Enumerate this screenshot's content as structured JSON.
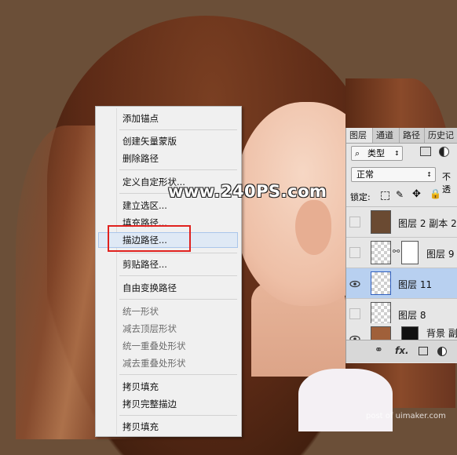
{
  "watermark": "www.240PS.com",
  "watermark_bottom": "post of uimaker.com",
  "context_menu": {
    "items": [
      {
        "label": "添加锚点",
        "enabled": true
      },
      {
        "label": "创建矢量蒙版",
        "enabled": true
      },
      {
        "label": "删除路径",
        "enabled": true
      },
      {
        "label": "定义自定形状...",
        "enabled": true
      },
      {
        "label": "建立选区...",
        "enabled": true
      },
      {
        "label": "填充路径...",
        "enabled": true
      },
      {
        "label": "描边路径...",
        "enabled": true,
        "highlighted": true
      },
      {
        "label": "剪贴路径...",
        "enabled": true
      },
      {
        "label": "自由变换路径",
        "enabled": true
      },
      {
        "label": "统一形状",
        "enabled": false
      },
      {
        "label": "减去顶层形状",
        "enabled": false
      },
      {
        "label": "统一重叠处形状",
        "enabled": false
      },
      {
        "label": "减去重叠处形状",
        "enabled": false
      },
      {
        "label": "拷贝填充",
        "enabled": true
      },
      {
        "label": "拷贝完整描边",
        "enabled": true
      },
      {
        "label": "拷贝填充",
        "enabled": true
      }
    ]
  },
  "layers_panel": {
    "tabs": [
      "图层",
      "通道",
      "路径",
      "历史记"
    ],
    "active_tab": "图层",
    "kind_filter": "类型",
    "blend_mode": "正常",
    "opacity_label": "不透",
    "lock_label": "锁定:",
    "layers": [
      {
        "name": "图层 2 副本 2",
        "visible": false,
        "selected": false,
        "thumb": "brown",
        "mask": false
      },
      {
        "name": "图层 9",
        "visible": false,
        "selected": false,
        "thumb": "transparent",
        "mask": true
      },
      {
        "name": "图层 11",
        "visible": true,
        "selected": true,
        "thumb": "transparent",
        "mask": false
      },
      {
        "name": "图层 8",
        "visible": false,
        "selected": false,
        "thumb": "transparent",
        "mask": false
      },
      {
        "name": "背景 副",
        "visible": true,
        "selected": false,
        "thumb": "photo",
        "mask": true
      }
    ],
    "bottom_icons": [
      "link-icon",
      "fx-icon",
      "mask-icon",
      "adjustment-icon"
    ],
    "fx_label": "fx."
  },
  "colors": {
    "background": "#6b4f38",
    "menu_bg": "#f0f0f0",
    "highlight": "#dfe9f5",
    "red_frame": "#e0211e",
    "selected_layer": "#b8d0f0"
  }
}
